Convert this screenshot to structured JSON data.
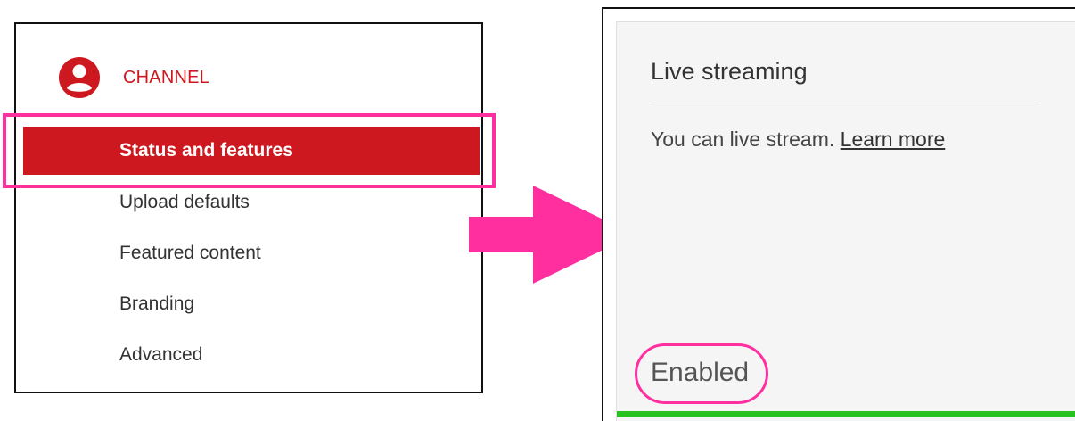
{
  "sidebar": {
    "section_title": "CHANNEL",
    "section_icon": "account-circle-icon",
    "items": [
      {
        "label": "Status and features",
        "active": true
      },
      {
        "label": "Upload defaults",
        "active": false
      },
      {
        "label": "Featured content",
        "active": false
      },
      {
        "label": "Branding",
        "active": false
      },
      {
        "label": "Advanced",
        "active": false
      }
    ]
  },
  "card": {
    "title": "Live streaming",
    "description": "You can live stream.",
    "link_label": "Learn more",
    "status": "Enabled",
    "status_color": "#27c21f"
  },
  "colors": {
    "brand_red": "#cc181e",
    "annotation_pink": "#ff2fa0"
  }
}
